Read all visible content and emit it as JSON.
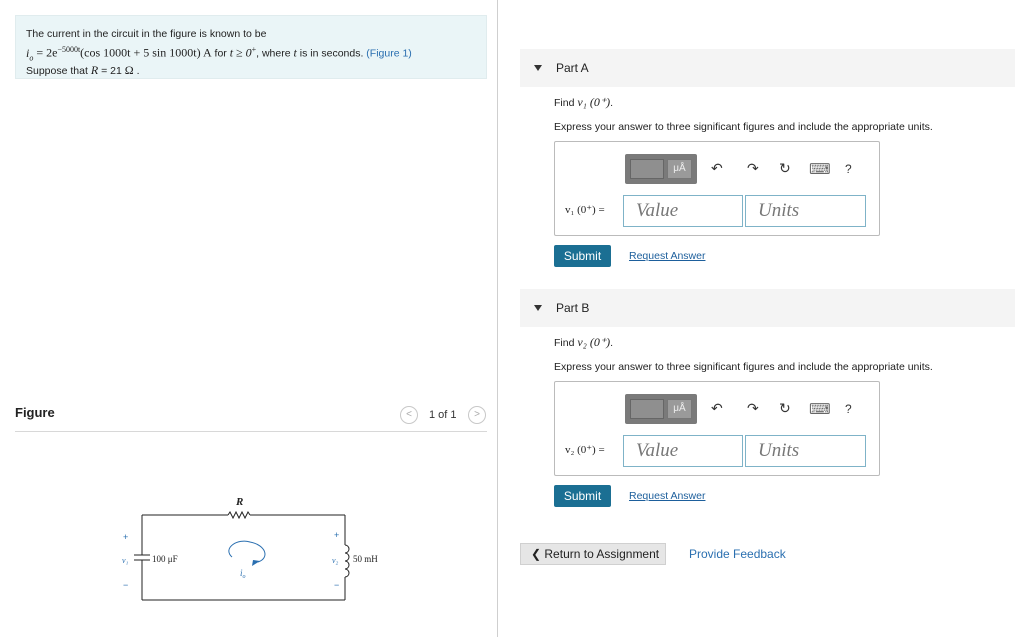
{
  "problem": {
    "line1": "The current in the circuit in the figure is known to be",
    "eq_lhs": "i",
    "eq_sub": "o",
    "eq_mid": " = 2e",
    "eq_exp": "−5000t",
    "eq_rest": "(cos 1000t + 5 sin 1000t) A",
    "eq_for": " for ",
    "eq_cond": "t ≥ 0",
    "eq_cond_sup": "+",
    "eq_tail": ", where ",
    "eq_t": "t",
    "eq_tail2": " is in seconds. ",
    "figure_link": "(Figure 1)",
    "line3_a": "Suppose that ",
    "line3_R": "R",
    "line3_b": " = 21 ",
    "line3_unit": "Ω",
    "line3_dot": " ."
  },
  "figure": {
    "title": "Figure",
    "pager": "1 of 1",
    "prev": "<",
    "next": ">",
    "R_label": "R",
    "cap_label": "100 μF",
    "ind_label": "50 mH",
    "v1_label": "v₁",
    "v2_label": "v₂",
    "io_label": "i",
    "io_sub": "o",
    "plus": "+",
    "minus": "−"
  },
  "partA": {
    "header": "Part A",
    "find_a": "Find ",
    "find_var": "v₁ (0⁺)",
    "find_b": ".",
    "express": "Express your answer to three significant figures and include the appropriate units.",
    "eq_label": "v₁ (0⁺) =",
    "value_placeholder": "Value",
    "units_placeholder": "Units",
    "submit": "Submit",
    "request": "Request Answer"
  },
  "partB": {
    "header": "Part B",
    "find_a": "Find ",
    "find_var": "v₂ (0⁺)",
    "find_b": ".",
    "express": "Express your answer to three significant figures and include the appropriate units.",
    "eq_label": "v₂ (0⁺) =",
    "value_placeholder": "Value",
    "units_placeholder": "Units",
    "submit": "Submit",
    "request": "Request Answer"
  },
  "toolbar": {
    "mu_a": "μÅ",
    "undo": "↶",
    "redo": "↷",
    "reset": "↻",
    "keyboard": "⌨",
    "help": "?"
  },
  "footer": {
    "return": "❮ Return to Assignment",
    "feedback": "Provide Feedback"
  },
  "icons": {
    "collapse": "triangle-down-icon"
  }
}
